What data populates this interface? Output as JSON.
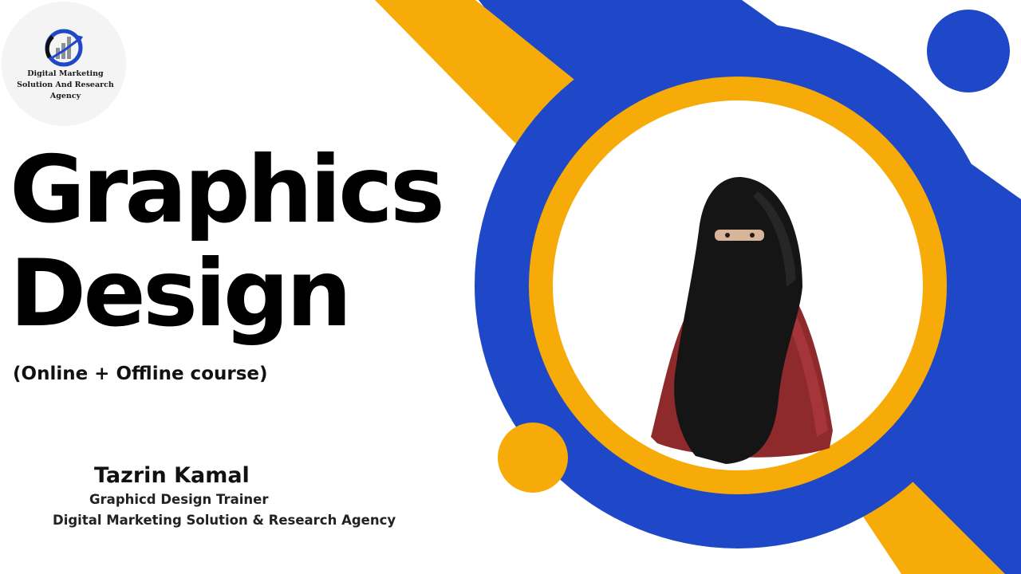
{
  "colors": {
    "blue": "#1f48c8",
    "blue_dark": "#1438a8",
    "orange": "#f7ab08",
    "orange_dark": "#f39a06",
    "text": "#000000"
  },
  "logo": {
    "icon": "bar-chart-growth-icon",
    "text": "Digital Marketing Solution And Research Agency"
  },
  "headline": {
    "line1": "Graphics",
    "line2": "Design"
  },
  "subtitle": "(Online + Offline course)",
  "trainer": {
    "name": "Tazrin Kamal",
    "role": "Graphicd Design Trainer",
    "organization": "Digital Marketing Solution & Research Agency"
  },
  "portrait": {
    "icon": "person-portrait-icon"
  }
}
